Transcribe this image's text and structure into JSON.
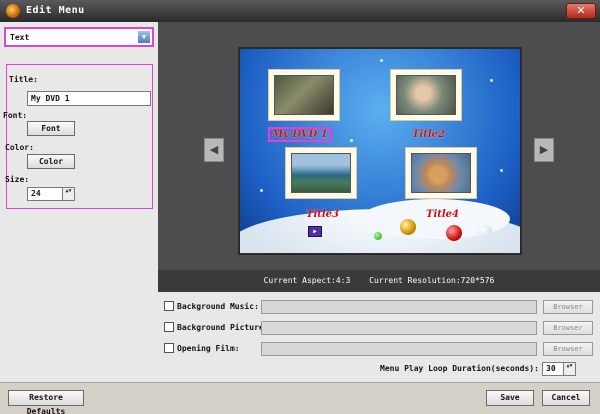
{
  "window": {
    "title": "Edit Menu",
    "close_glyph": "✕"
  },
  "left_panel": {
    "type_select": {
      "value": "Text",
      "arrow": "▼"
    },
    "title_label": "Title:",
    "title_value": "My DVD 1",
    "font_label": "Font:",
    "font_button": "Font",
    "color_label": "Color:",
    "color_button": "Color",
    "size_label": "Size:",
    "size_value": "24",
    "spin_glyph": "▲▼"
  },
  "preview": {
    "prev_glyph": "◀",
    "next_glyph": "▶",
    "titles": [
      "My DVD 1",
      "Title2",
      "Title3",
      "Title4"
    ],
    "play_glyph": "▶"
  },
  "info": {
    "aspect": "Current Aspect:4:3",
    "resolution": "Current Resolution:720*576"
  },
  "options": {
    "bg_music": {
      "label": "Background Music:",
      "browse": "Browser"
    },
    "bg_picture": {
      "label": "Background Picture:",
      "browse": "Browser"
    },
    "opening_film": {
      "label": "Opening Film:",
      "browse": "Browser"
    },
    "loop_label": "Menu Play Loop Duration(seconds):",
    "loop_value": "30"
  },
  "footer": {
    "restore": "Restore Defaults",
    "save": "Save",
    "cancel": "Cancel"
  },
  "colors": {
    "highlight": "#d946d4",
    "title_red": "#d01010"
  }
}
